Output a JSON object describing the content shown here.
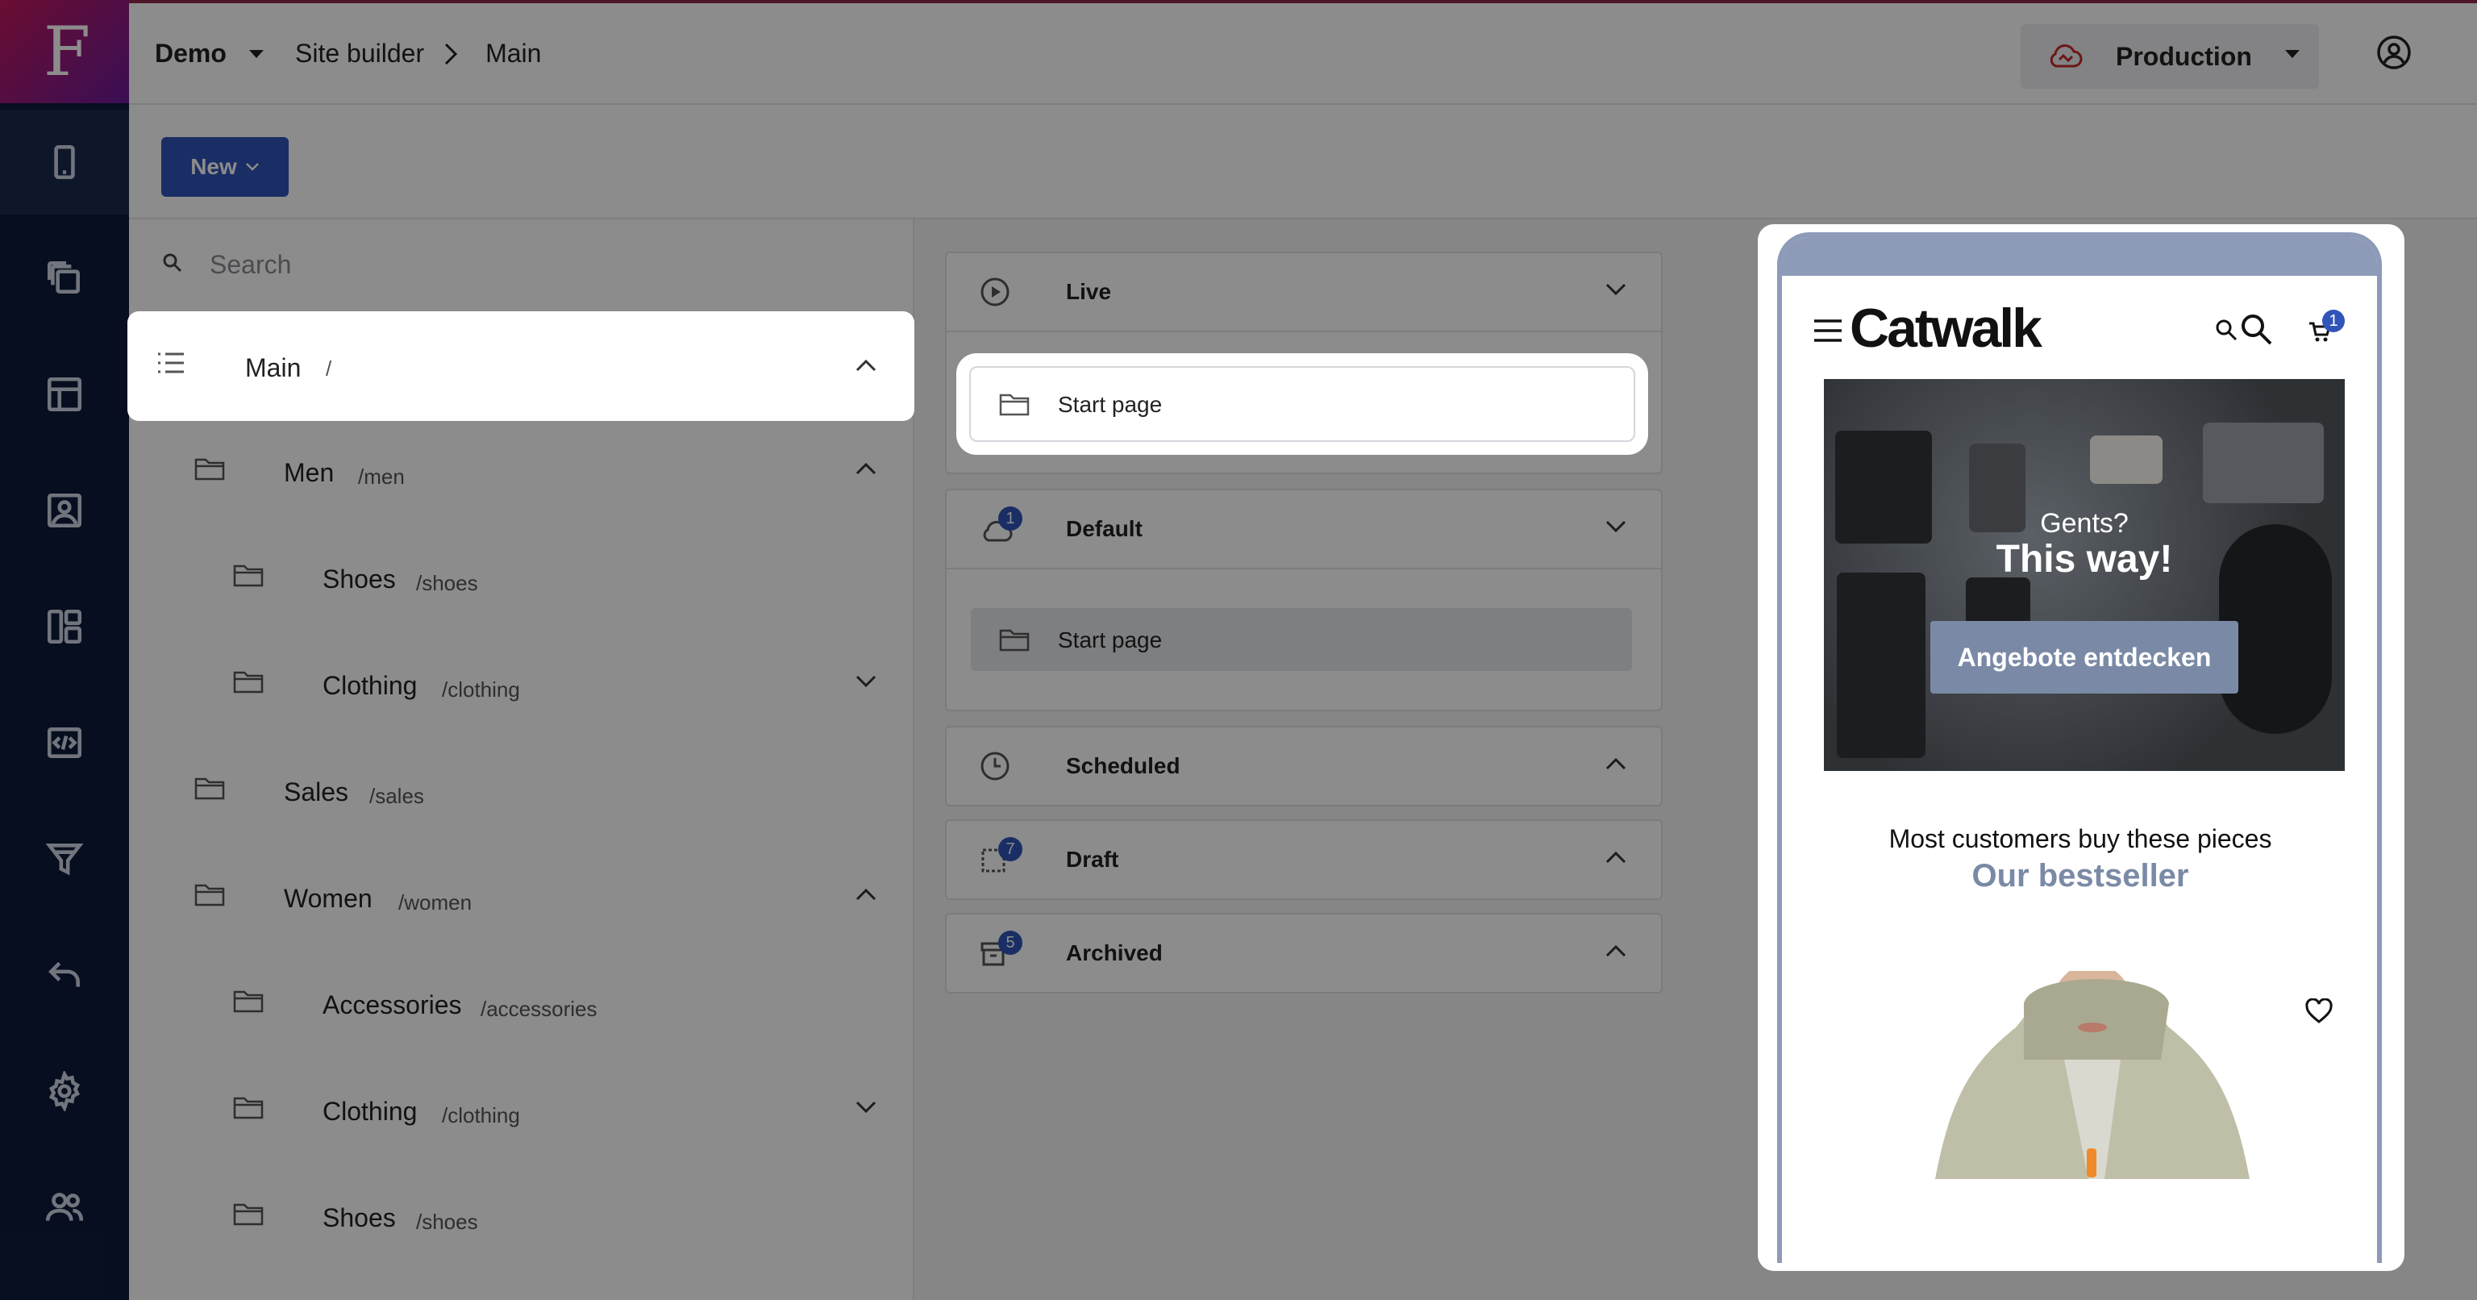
{
  "app": {
    "logo_letter": "F"
  },
  "rail": {
    "items": [
      {
        "icon": "mobile-icon"
      },
      {
        "icon": "pages-icon"
      },
      {
        "icon": "layout-icon"
      },
      {
        "icon": "image-icon"
      },
      {
        "icon": "dashboard-icon"
      },
      {
        "icon": "code-icon"
      },
      {
        "icon": "filter-icon"
      },
      {
        "icon": "undo-icon"
      },
      {
        "icon": "gear-icon"
      },
      {
        "icon": "users-icon"
      }
    ]
  },
  "topbar": {
    "project": "Demo",
    "breadcrumb": [
      "Site builder",
      "Main"
    ],
    "environment": "Production"
  },
  "toolbar": {
    "new_label": "New"
  },
  "tree": {
    "search_placeholder": "Search",
    "nodes": [
      {
        "name": "Main",
        "path": "/",
        "expanded": true
      },
      {
        "name": "Men",
        "path": "/men",
        "expanded": true
      },
      {
        "name": "Shoes",
        "path": "/shoes"
      },
      {
        "name": "Clothing",
        "path": "/clothing",
        "expanded": false
      },
      {
        "name": "Sales",
        "path": "/sales"
      },
      {
        "name": "Women",
        "path": "/women",
        "expanded": true
      },
      {
        "name": "Accessories",
        "path": "/accessories"
      },
      {
        "name": "Clothing",
        "path": "/clothing",
        "expanded": false
      },
      {
        "name": "Shoes",
        "path": "/shoes"
      }
    ]
  },
  "versions": {
    "live": {
      "title": "Live",
      "page": "Start page"
    },
    "default": {
      "title": "Default",
      "badge": "1",
      "page": "Start page"
    },
    "scheduled": {
      "title": "Scheduled"
    },
    "draft": {
      "title": "Draft",
      "badge": "7"
    },
    "archived": {
      "title": "Archived",
      "badge": "5"
    }
  },
  "preview": {
    "brand": "Catwalk",
    "cart_count": "1",
    "hero_line1": "Gents?",
    "hero_line2": "This way!",
    "hero_cta": "Angebote entdecken",
    "tagline": "Most customers buy these pieces",
    "section_title": "Our bestseller"
  },
  "colors": {
    "accent": "#3154b8",
    "rail": "#0c1b3a",
    "brand_gradient_start": "#c2185b",
    "brand_gradient_end": "#6a1b9a"
  }
}
